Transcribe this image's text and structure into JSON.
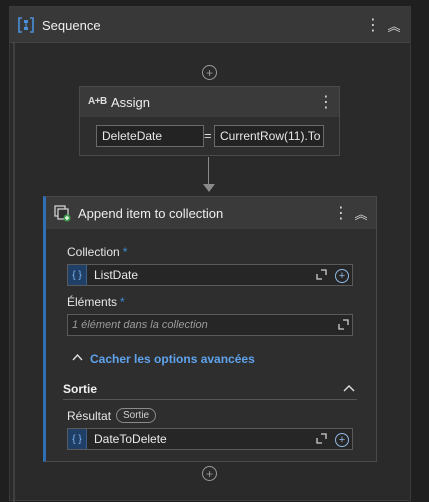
{
  "sequence": {
    "title": "Sequence",
    "menu_glyph": "⋮",
    "collapse_glyph": "︽"
  },
  "add_glyph": "+",
  "assign": {
    "title": "Assign",
    "icon_text": "A+B",
    "menu_glyph": "⋮",
    "to_value": "DeleteDate",
    "equals": "=",
    "value_expr": "CurrentRow(11).To"
  },
  "append": {
    "title": "Append item to collection",
    "menu_glyph": "⋮",
    "collapse_glyph": "︽",
    "collection_label": "Collection",
    "required_mark": "*",
    "collection_value": "ListDate",
    "elements_label": "Éléments",
    "elements_placeholder": "1 élément dans la collection",
    "advanced_toggle": "Cacher les options avancées",
    "output_section": "Sortie",
    "result_label": "Résultat",
    "result_badge": "Sortie",
    "result_value": "DateToDelete"
  },
  "brace_glyph": "{ }",
  "chevron_up": "⌃",
  "colors": {
    "accent": "#2f6fb5",
    "link": "#5fa3ec",
    "background": "#1f1f1f"
  }
}
